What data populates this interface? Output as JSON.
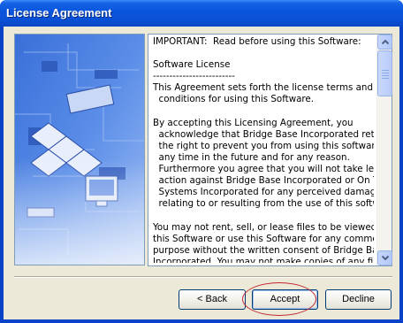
{
  "window": {
    "title": "License Agreement"
  },
  "license": {
    "lines": [
      "IMPORTANT:  Read before using this Software:",
      "",
      "Software License",
      "-------------------------",
      "This Agreement sets forth the license terms and",
      "  conditions for using this Software.",
      "",
      "By accepting this Licensing Agreement, you",
      "  acknowledge that Bridge Base Incorporated retains",
      "  the right to prevent you from using this software at",
      "  any time in the future and for any reason.",
      "  Furthermore you agree that you will not take legal",
      "  action against Bridge Base Incorporated or On Time",
      "  Systems Incorporated for any perceived damages",
      "  relating to or resulting from the use of this software.",
      "",
      "You may not rent, sell, or lease files to be viewed with",
      "this Software or use this Software for any commercial",
      "purpose without the written consent of Bridge Base",
      "Incorporated. You may not make copies of any files"
    ]
  },
  "buttons": {
    "back_label": "< Back",
    "accept_label": "Accept",
    "decline_label": "Decline"
  }
}
